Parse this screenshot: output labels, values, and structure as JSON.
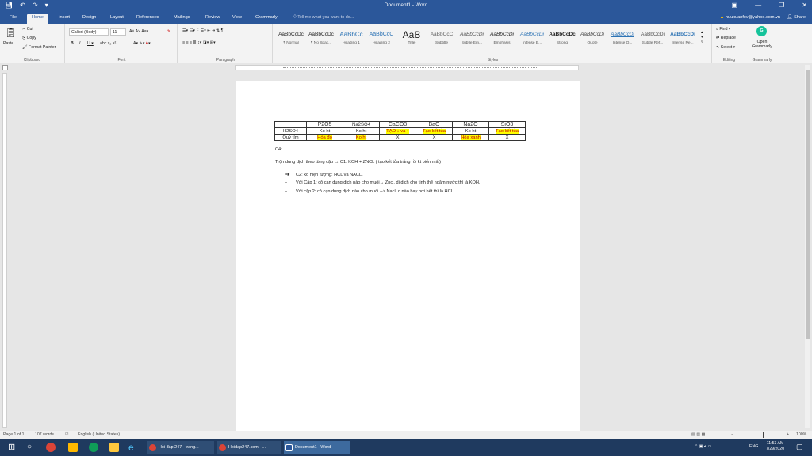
{
  "titlebar": {
    "doc_title": "Document1 - Word"
  },
  "tabs": {
    "items": [
      "File",
      "Home",
      "Insert",
      "Design",
      "Layout",
      "References",
      "Mailings",
      "Review",
      "View",
      "Grammarly"
    ],
    "active": "Home",
    "tell_me": "Tell me what you want to do...",
    "account": "huuxuanfcv@yahoo.com.vn",
    "share": "Share"
  },
  "ribbon": {
    "clipboard": {
      "cut": "Cut",
      "copy": "Copy",
      "paste": "Paste",
      "format_painter": "Format Painter",
      "label": "Clipboard"
    },
    "font": {
      "font_name": "Calibri (Body)",
      "font_size": "11",
      "label": "Font"
    },
    "paragraph": {
      "label": "Paragraph"
    },
    "styles": {
      "label": "Styles",
      "items": [
        {
          "sample": "AaBbCcDc",
          "name": "¶ Normal"
        },
        {
          "sample": "AaBbCcDc",
          "name": "¶ No Spac..."
        },
        {
          "sample": "AaBbCc",
          "name": "Heading 1"
        },
        {
          "sample": "AaBbCcC",
          "name": "Heading 2"
        },
        {
          "sample": "AaB",
          "name": "Title"
        },
        {
          "sample": "AaBbCcC",
          "name": "Subtitle"
        },
        {
          "sample": "AaBbCcDi",
          "name": "Subtle Em..."
        },
        {
          "sample": "AaBbCcDi",
          "name": "Emphasis"
        },
        {
          "sample": "AaBbCcDi",
          "name": "Intense E..."
        },
        {
          "sample": "AaBbCcDc",
          "name": "Strong"
        },
        {
          "sample": "AaBbCcDi",
          "name": "Quote"
        },
        {
          "sample": "AaBbCcDi",
          "name": "Intense Q..."
        },
        {
          "sample": "AaBbCcDi",
          "name": "Subtle Ref..."
        },
        {
          "sample": "AaBbCcDi",
          "name": "Intense Re..."
        }
      ]
    },
    "editing": {
      "find": "Find",
      "replace": "Replace",
      "select": "Select",
      "label": "Editing"
    },
    "grammarly": {
      "open": "Open Grammarly",
      "label": "Grammarly"
    }
  },
  "document": {
    "table": {
      "headers": [
        "",
        "P2O5",
        "Na2SO4",
        "CaCO3",
        "BaO",
        "Na2O",
        "SiO3"
      ],
      "rows": [
        [
          "H2SO4",
          "Ko ht",
          "Ko ht",
          "TẠO ↓ và ↑",
          "Tạo kết tủa",
          "Ko ht",
          "Tạo kết tủa"
        ],
        [
          "Quỳ tím",
          "Hóa đỏ",
          "Ko ht",
          "X",
          "X",
          "Hóa xanh",
          "X"
        ]
      ]
    },
    "c4": "C4:",
    "line1": "Trộn dung dịch theo từng cặp → C1: KOH + ZNCL ( tạo kết tủa trắng rồi kt biến mất)",
    "line2": "C2: ko hiện tượng: HCL và NACL.",
    "line3": "Với Cặp 1: cô cạn dung dịch nào cho muối→ Zncl, dị dịch  cho tinh thể ngậm nước thì là KOH.",
    "line4": "Với cặp 2: cô cạn dung dịch nào cho muối --> Nacl, d nào bay hơi hết thì là HCL"
  },
  "statusbar": {
    "page": "Page 1 of 1",
    "words": "107 words",
    "language": "English (United States)",
    "zoom": "100%"
  },
  "taskbar": {
    "items": [
      "Hỏi đáp 247 - trang...",
      "Hoidap247.com - ...",
      "Document1 - Word"
    ],
    "language": "ENG",
    "time": "11:53 AM",
    "date": "7/29/2020"
  },
  "colors": {
    "word_blue": "#2b579a",
    "highlight": "#ffff00",
    "taskbar": "#1f3a5f"
  }
}
